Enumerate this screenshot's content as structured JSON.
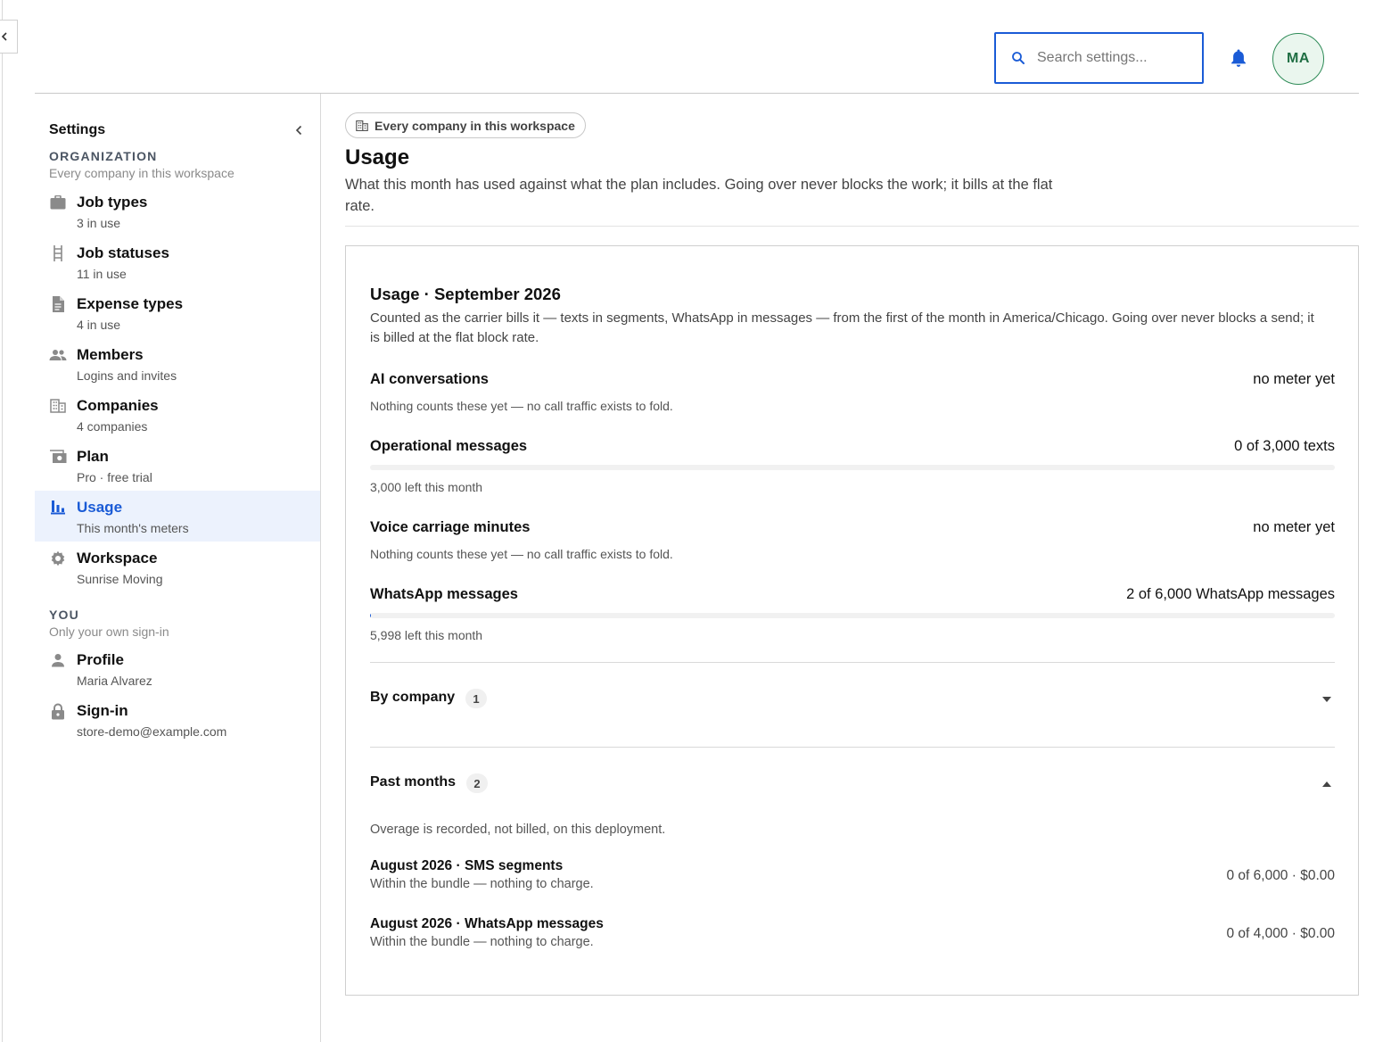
{
  "header": {
    "search_placeholder": "Search settings...",
    "avatar_initials": "MA",
    "accent_color": "#1a5bd6",
    "avatar_color": "#2e8b57"
  },
  "sidebar": {
    "title": "Settings",
    "org_heading": "ORGANIZATION",
    "org_sub": "Every company in this workspace",
    "org_items": [
      {
        "label": "Job types",
        "meta": "3 in use",
        "icon": "briefcase-icon"
      },
      {
        "label": "Job statuses",
        "meta": "11 in use",
        "icon": "ladder-icon"
      },
      {
        "label": "Expense types",
        "meta": "4 in use",
        "icon": "document-icon"
      },
      {
        "label": "Members",
        "meta": "Logins and invites",
        "icon": "people-icon"
      },
      {
        "label": "Companies",
        "meta": "4 companies",
        "icon": "building-icon"
      },
      {
        "label": "Plan",
        "meta": "Pro · free trial",
        "icon": "money-icon"
      },
      {
        "label": "Usage",
        "meta": "This month's meters",
        "icon": "bar-chart-icon",
        "active": true
      },
      {
        "label": "Workspace",
        "meta": "Sunrise Moving",
        "icon": "gear-icon"
      }
    ],
    "you_heading": "YOU",
    "you_sub": "Only your own sign-in",
    "you_items": [
      {
        "label": "Profile",
        "meta": "Maria Alvarez",
        "icon": "person-icon"
      },
      {
        "label": "Sign-in",
        "meta": "store-demo@example.com",
        "icon": "lock-icon"
      }
    ]
  },
  "main": {
    "scope_chip": "Every company in this workspace",
    "title": "Usage",
    "description": "What this month has used against what the plan includes. Going over never blocks the work; it bills at the flat rate.",
    "card": {
      "title": "Usage · September 2026",
      "description": "Counted as the carrier bills it — texts in segments, WhatsApp in messages — from the first of the month in America/Chicago. Going over never blocks a send; it is billed at the flat block rate.",
      "meters": [
        {
          "name": "AI conversations",
          "value": "no meter yet",
          "note": "Nothing counts these yet — no call traffic exists to fold."
        },
        {
          "name": "Operational messages",
          "value": "0 of 3,000 texts",
          "note": "3,000 left this month",
          "used_fraction": 0
        },
        {
          "name": "Voice carriage minutes",
          "value": "no meter yet",
          "note": "Nothing counts these yet — no call traffic exists to fold."
        },
        {
          "name": "WhatsApp messages",
          "value": "2 of 6,000 WhatsApp messages",
          "note": "5,998 left this month",
          "used_fraction": 0.00033
        }
      ],
      "by_company": {
        "title": "By company",
        "count": "1",
        "expanded": false
      },
      "past_months": {
        "title": "Past months",
        "count": "2",
        "expanded": true,
        "note": "Overage is recorded, not billed, on this deployment.",
        "rows": [
          {
            "title": "August 2026 · SMS segments",
            "sub": "Within the bundle — nothing to charge.",
            "value": "0 of 6,000 · $0.00"
          },
          {
            "title": "August 2026 · WhatsApp messages",
            "sub": "Within the bundle — nothing to charge.",
            "value": "0 of 4,000 · $0.00"
          }
        ]
      }
    }
  }
}
